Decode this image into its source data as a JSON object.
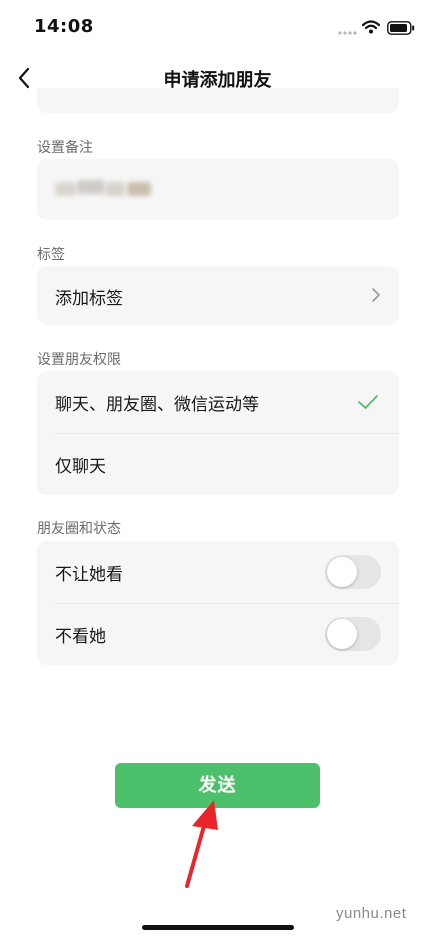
{
  "status_bar": {
    "time": "14:08",
    "icons": [
      "signal-icon",
      "wifi-icon",
      "battery-icon"
    ]
  },
  "nav": {
    "title": "申请添加朋友",
    "back_icon": "chevron-left-icon"
  },
  "remark": {
    "label": "设置备注",
    "value_blurred": true
  },
  "tags": {
    "label": "标签",
    "row_label": "添加标签",
    "row_icon": "chevron-right-icon"
  },
  "permissions": {
    "label": "设置朋友权限",
    "options": [
      {
        "label": "聊天、朋友圈、微信运动等",
        "selected": true
      },
      {
        "label": "仅聊天",
        "selected": false
      }
    ]
  },
  "moments": {
    "label": "朋友圈和状态",
    "toggles": [
      {
        "label": "不让她看",
        "on": false
      },
      {
        "label": "不看她",
        "on": false
      }
    ]
  },
  "send_button": {
    "label": "发送"
  },
  "watermark": "yunhu.net",
  "colors": {
    "accent": "#4cc06a",
    "card_bg": "#f6f6f6",
    "annotation_arrow": "#e8262a"
  }
}
